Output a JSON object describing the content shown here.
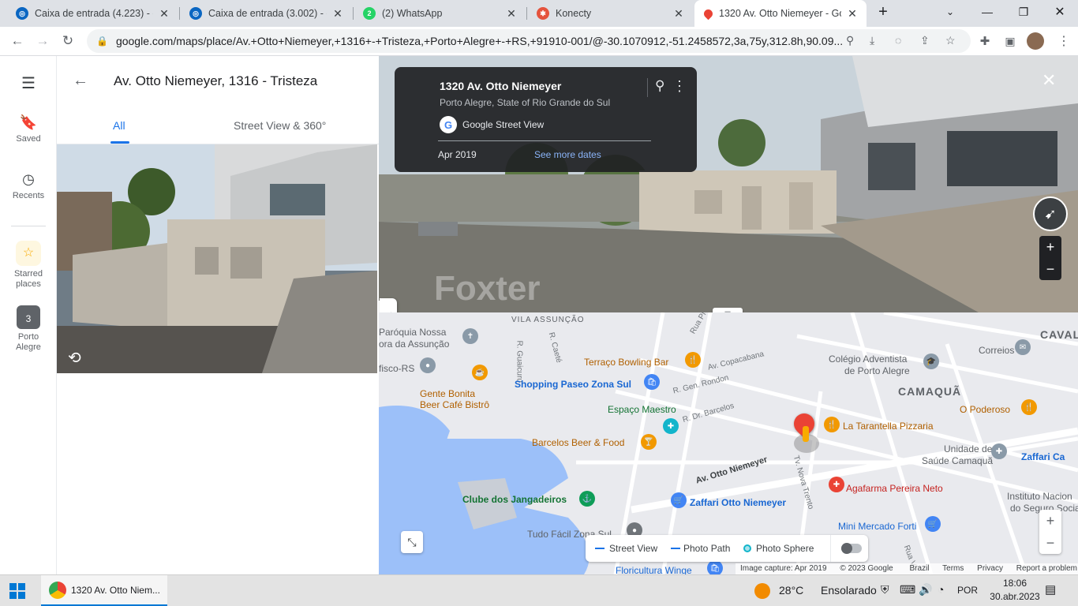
{
  "browser": {
    "tabs": [
      {
        "title": "Caixa de entrada (4.223) - ed",
        "icon": "outlook-icon",
        "color": "#0a66c2"
      },
      {
        "title": "Caixa de entrada (3.002) - ed",
        "icon": "outlook-icon",
        "color": "#0a66c2"
      },
      {
        "title": "(2) WhatsApp",
        "icon": "whatsapp-icon",
        "color": "#25d366",
        "badge": "2"
      },
      {
        "title": "Konecty",
        "icon": "konecty-icon",
        "color": "#e5533d"
      },
      {
        "title": "1320 Av. Otto Niemeyer - Go",
        "icon": "maps-icon",
        "color": "#ea4335"
      }
    ],
    "url": "google.com/maps/place/Av.+Otto+Niemeyer,+1316+-+Tristeza,+Porto+Alegre+-+RS,+91910-001/@-30.1070912,-51.2458572,3a,75y,312.8h,90.09..."
  },
  "rail": {
    "saved": "Saved",
    "recents": "Recents",
    "starred": "Starred places",
    "porto_alegre": "Porto Alegre",
    "porto_badge": "3"
  },
  "panel": {
    "title": "Av. Otto Niemeyer, 1316 - Tristeza",
    "tab_all": "All",
    "tab_sv": "Street View & 360°"
  },
  "streetview": {
    "address": "1320 Av. Otto Niemeyer",
    "region": "Porto Alegre, State of Rio Grande do Sul",
    "source": "Google Street View",
    "date": "Apr 2019",
    "more_dates": "See more dates",
    "watermark": "Foxter"
  },
  "map": {
    "labels": {
      "vila_assuncao": "VILA ASSUNÇÃO",
      "paroquia": "Paróquia Nossa",
      "paroquia2": "ora da Assunção",
      "fisco": "fisco-RS",
      "guaicuru": "R. Guaicuru",
      "caete": "R. Caeté",
      "terraco": "Terraço Bowling Bar",
      "av_copacabana": "Av. Copacabana",
      "shopping": "Shopping Paseo Zona Sul",
      "gente": "Gente Bonita",
      "gente2": "Beer Café Bistrô",
      "gen_rondon": "R. Gen. Rondon",
      "espaco": "Espaço Maestro",
      "dr_barcelos": "R. Dr. Barcelos",
      "barcelos": "Barcelos Beer & Food",
      "otto": "Av. Otto Niemeyer",
      "clube": "Clube dos Jangadeiros",
      "zaffari_otto": "Zaffari Otto Niemeyer",
      "tudo": "Tudo Fácil Zona Sul",
      "floricultura": "Floricultura Winge",
      "colegio": "Colégio Adventista",
      "colegio2": "de Porto Alegre",
      "correios": "Correios",
      "cava": "CAVAL",
      "camaqua": "CAMAQUÃ",
      "tarantella": "La Tarantella Pizzaria",
      "poderoso": "O Poderoso",
      "unidade": "Unidade de",
      "unidade2": "Saúde Camaquã",
      "zaffari_ca": "Zaffari Ca",
      "agafarma": "Agafarma Pereira Neto",
      "instituto": "Instituto Nacion",
      "instituto2": "do Seguro Socia",
      "mini": "Mini Mercado Forti",
      "nova_trento": "Tv. Nova Trento",
      "rua_pl": "Rua Pl",
      "rua_vi": "Rua Vi"
    },
    "legend": {
      "street_view": "Street View",
      "photo_path": "Photo Path",
      "photo_sphere": "Photo Sphere"
    },
    "footer": [
      "Image capture: Apr 2019",
      "© 2023 Google",
      "Brazil",
      "Terms",
      "Privacy",
      "Report a problem"
    ]
  },
  "taskbar": {
    "app_title": "1320 Av. Otto Niem...",
    "temp": "28°C",
    "weather": "Ensolarado",
    "lang": "POR",
    "time": "18:06",
    "date": "30.abr.2023"
  }
}
